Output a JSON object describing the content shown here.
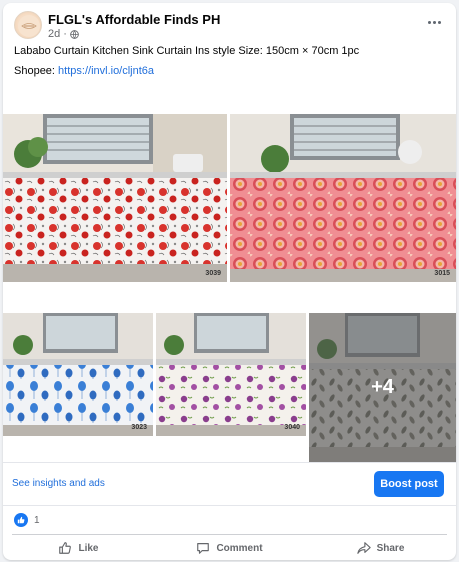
{
  "page": {
    "name": "FLGL's Affordable Finds PH",
    "time": "2d",
    "dot": "·",
    "audience_icon": "globe-icon"
  },
  "post": {
    "text": "Lababo Curtain Kitchen Sink Curtain Ins style Size: 150cm × 70cm 1pc",
    "shopee_label": "Shopee:",
    "shopee_link": "https://invl.io/cljnt6a"
  },
  "gallery": {
    "photos": [
      {
        "code": "3039",
        "pattern": "red roses on white"
      },
      {
        "code": "3015",
        "pattern": "pink medallions"
      },
      {
        "code": "3023",
        "pattern": "blue tulips on white"
      },
      {
        "code": "3040",
        "pattern": "purple flowers on white"
      },
      {
        "code": "",
        "pattern": "leaves on grey"
      }
    ],
    "more_count": "+4"
  },
  "insights": {
    "link_label": "See insights and ads",
    "boost_label": "Boost post"
  },
  "reactions": {
    "count": "1",
    "icon": "like-icon"
  },
  "actions": {
    "like": "Like",
    "comment": "Comment",
    "share": "Share"
  },
  "colors": {
    "accent": "#1877f2",
    "link": "#216fdb",
    "secondary_text": "#65676b"
  }
}
